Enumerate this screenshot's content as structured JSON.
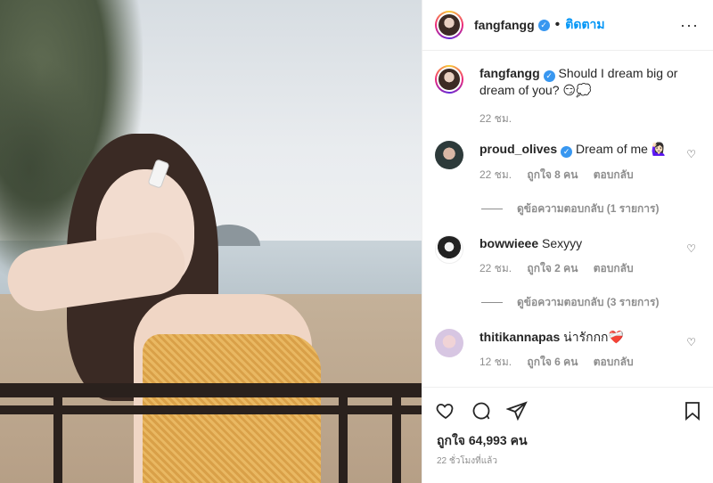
{
  "header": {
    "username": "fangfangg",
    "follow_label": "ติดตาม",
    "more": "···"
  },
  "caption": {
    "username": "fangfangg",
    "text": "Should I dream big or dream of you? 😏💭",
    "time": "22 ชม."
  },
  "comments": [
    {
      "username": "proud_olives",
      "verified": true,
      "text": "Dream of me 🙋🏻‍♀️",
      "time": "22 ชม.",
      "likes": "ถูกใจ 8 คน",
      "reply": "ตอบกลับ",
      "view_replies": "ดูข้อความตอบกลับ (1 รายการ)"
    },
    {
      "username": "bowwieee",
      "verified": false,
      "text": "Sexyyy",
      "time": "22 ชม.",
      "likes": "ถูกใจ 2 คน",
      "reply": "ตอบกลับ",
      "view_replies": "ดูข้อความตอบกลับ (3 รายการ)"
    },
    {
      "username": "thitikannapas",
      "verified": false,
      "text": "น่ารักกก❤️‍🩹",
      "time": "12 ชม.",
      "likes": "ถูกใจ 6 คน",
      "reply": "ตอบกลับ",
      "view_replies": ""
    }
  ],
  "footer": {
    "likes": "ถูกใจ 64,993 คน",
    "time": "22 ชั่วโมงที่แล้ว"
  },
  "icons": [
    "heart-icon",
    "comment-icon",
    "share-icon",
    "bookmark-icon",
    "verified-icon",
    "more-icon"
  ],
  "colors": {
    "accent": "#0095f6",
    "verified": "#3897f0",
    "muted": "#8e8e8e"
  }
}
